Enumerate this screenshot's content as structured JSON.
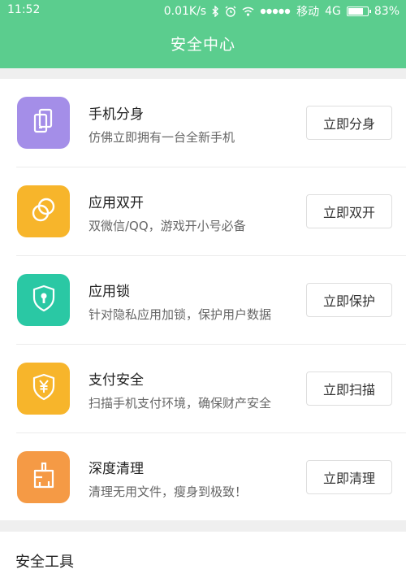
{
  "status_bar": {
    "time": "11:52",
    "speed": "0.01K/s",
    "carrier": "移动",
    "network": "4G",
    "battery": "83%",
    "battery_level": 0.83,
    "icons": [
      "bluetooth-icon",
      "alarm-icon",
      "wifi-icon",
      "signal-icon",
      "battery-icon"
    ]
  },
  "header": {
    "title": "安全中心"
  },
  "features": [
    {
      "title": "手机分身",
      "desc": "仿佛立即拥有一台全新手机",
      "button": "立即分身",
      "icon": "phone-clone-icon",
      "color": "#a48ee8"
    },
    {
      "title": "应用双开",
      "desc": "双微信/QQ，游戏开小号必备",
      "button": "立即双开",
      "icon": "dual-app-icon",
      "color": "#f7b52b"
    },
    {
      "title": "应用锁",
      "desc": "针对隐私应用加锁，保护用户数据",
      "button": "立即保护",
      "icon": "app-lock-icon",
      "color": "#2ac8a4"
    },
    {
      "title": "支付安全",
      "desc": "扫描手机支付环境，确保财产安全",
      "button": "立即扫描",
      "icon": "payment-shield-icon",
      "color": "#f7b52b"
    },
    {
      "title": "深度清理",
      "desc": "清理无用文件，瘦身到极致！",
      "button": "立即清理",
      "icon": "deep-clean-icon",
      "color": "#f59a45"
    }
  ],
  "section": {
    "title": "安全工具"
  }
}
